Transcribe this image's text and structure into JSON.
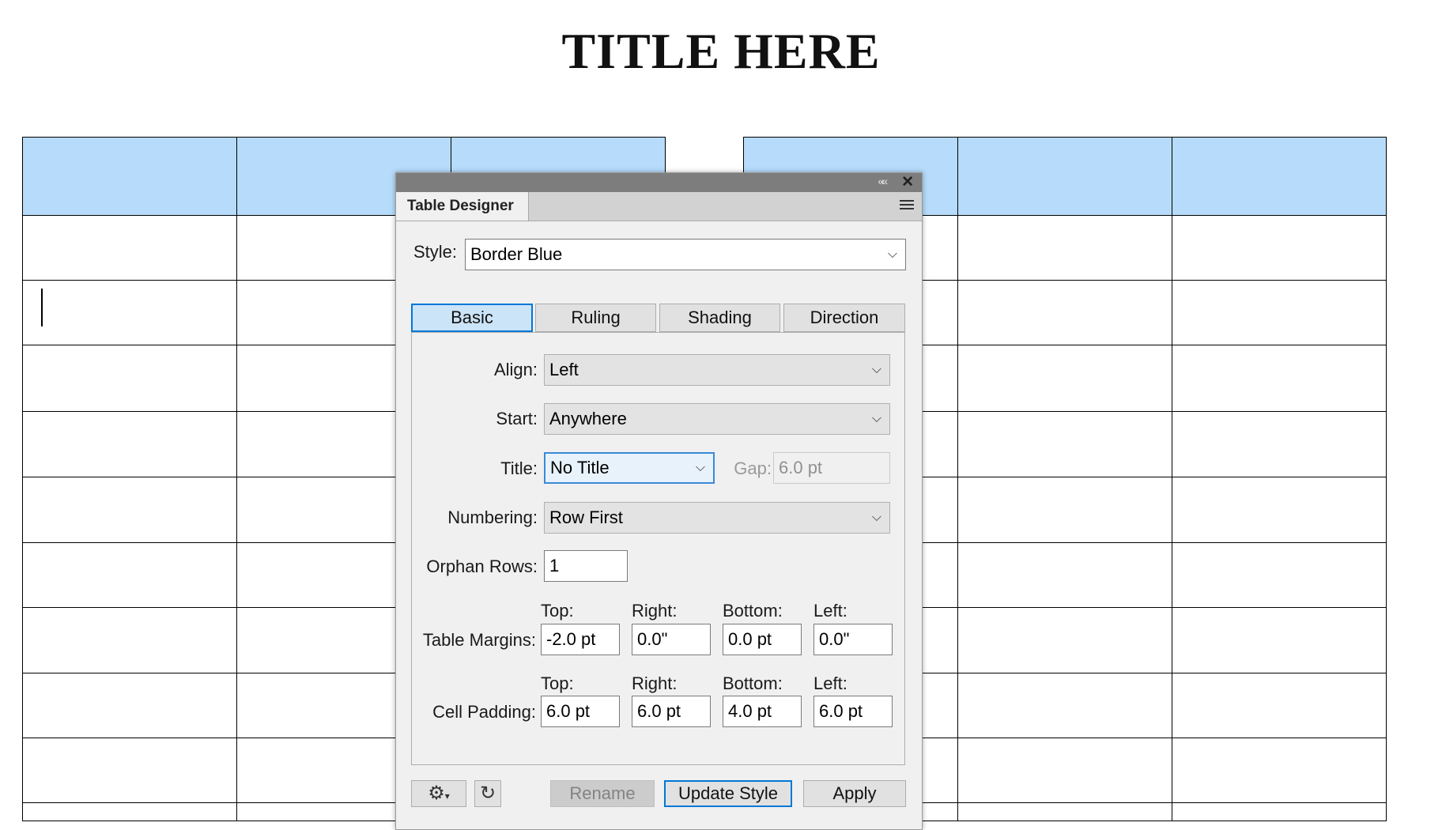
{
  "document": {
    "title": "TITLE HERE"
  },
  "panel": {
    "tab_label": "Table Designer",
    "collapse_glyph": "««",
    "close_glyph": "✕",
    "style_label": "Style:",
    "style_value": "Border Blue",
    "subtabs": [
      "Basic",
      "Ruling",
      "Shading",
      "Direction"
    ],
    "active_subtab": "Basic",
    "basic": {
      "align_label": "Align:",
      "align_value": "Left",
      "start_label": "Start:",
      "start_value": "Anywhere",
      "title_label": "Title:",
      "title_value": "No Title",
      "gap_label": "Gap:",
      "gap_value": "6.0 pt",
      "numbering_label": "Numbering:",
      "numbering_value": "Row First",
      "orphan_label": "Orphan Rows:",
      "orphan_value": "1",
      "margins_label": "Table Margins:",
      "padding_label": "Cell Padding:",
      "side_labels": {
        "top": "Top:",
        "right": "Right:",
        "bottom": "Bottom:",
        "left": "Left:"
      },
      "margins": {
        "top": "-2.0 pt",
        "right": "0.0\"",
        "bottom": "0.0 pt",
        "left": "0.0\""
      },
      "padding": {
        "top": "6.0 pt",
        "right": "6.0 pt",
        "bottom": "4.0 pt",
        "left": "6.0 pt"
      }
    },
    "buttons": {
      "rename": "Rename",
      "update_style": "Update Style",
      "apply": "Apply"
    },
    "icons": {
      "settings": "gear-icon",
      "refresh": "refresh-icon",
      "dropdown": "chevron-down-icon"
    },
    "colors": {
      "accent": "#0078d7",
      "header_cell": "#b7dbfb"
    }
  }
}
